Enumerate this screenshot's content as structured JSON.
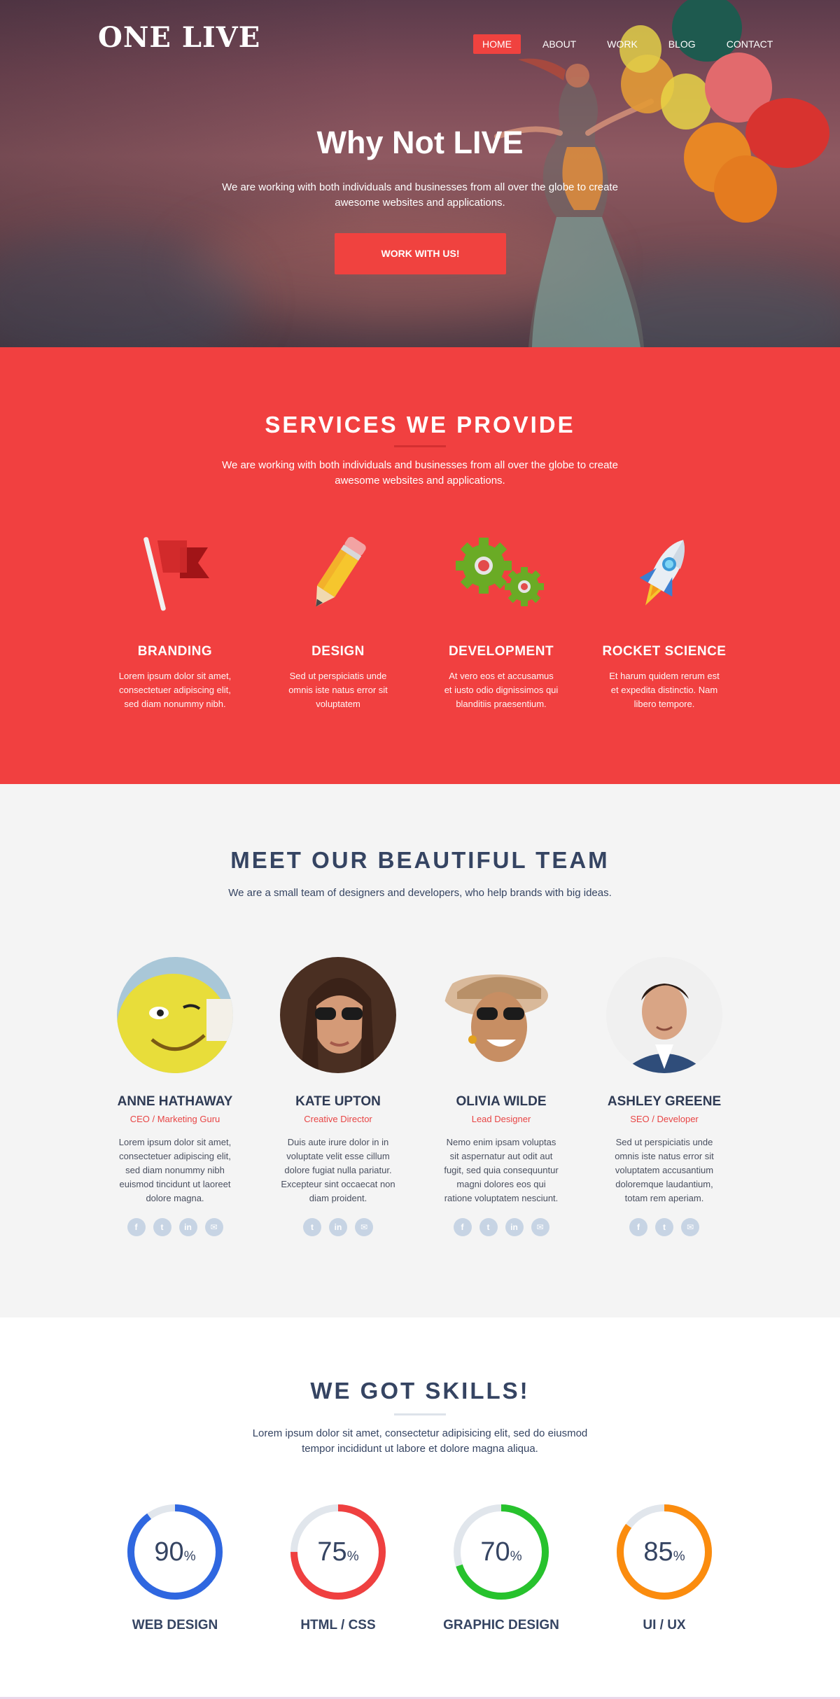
{
  "brand": {
    "logo": "ONE LIVE"
  },
  "nav": {
    "items": [
      "HOME",
      "ABOUT",
      "WORK",
      "BLOG",
      "CONTACT"
    ],
    "active": "HOME"
  },
  "hero": {
    "title_light": "Why Not ",
    "title_bold": "LIVE",
    "subtitle": "We are working with both individuals and businesses from all over the globe to create awesome websites and applications.",
    "cta": "WORK WITH US!"
  },
  "services": {
    "title": "SERVICES WE PROVIDE",
    "subtitle": "We are working with both individuals and businesses from all over the globe to create awesome websites and applications.",
    "items": [
      {
        "icon": "flag-icon",
        "title": "BRANDING",
        "text": "Lorem ipsum dolor sit amet, consectetuer adipiscing elit, sed diam nonummy nibh."
      },
      {
        "icon": "pencil-icon",
        "title": "DESIGN",
        "text": "Sed ut perspiciatis unde omnis iste natus error sit voluptatem"
      },
      {
        "icon": "gears-icon",
        "title": "DEVELOPMENT",
        "text": "At vero eos et accusamus et iusto odio dignissimos qui blanditiis praesentium."
      },
      {
        "icon": "rocket-icon",
        "title": "ROCKET SCIENCE",
        "text": "Et harum quidem rerum est et expedita distinctio. Nam libero tempore."
      }
    ]
  },
  "team": {
    "title": "MEET OUR BEAUTIFUL TEAM",
    "subtitle": "We are a small team of designers and developers, who help brands with big ideas.",
    "members": [
      {
        "name": "ANNE HATHAWAY",
        "role": "CEO / Marketing Guru",
        "bio": "Lorem ipsum dolor sit amet, consectetuer adipiscing elit, sed diam nonummy nibh euismod tincidunt ut laoreet dolore magna.",
        "socials": [
          "facebook-icon",
          "twitter-icon",
          "linkedin-icon",
          "mail-icon"
        ]
      },
      {
        "name": "KATE UPTON",
        "role": "Creative Director",
        "bio": "Duis aute irure dolor in in voluptate velit esse cillum dolore fugiat nulla pariatur. Excepteur sint occaecat non diam proident.",
        "socials": [
          "twitter-icon",
          "linkedin-icon",
          "mail-icon"
        ]
      },
      {
        "name": "OLIVIA WILDE",
        "role": "Lead Designer",
        "bio": "Nemo enim ipsam voluptas sit aspernatur aut odit aut fugit, sed quia consequuntur magni dolores eos qui ratione voluptatem nesciunt.",
        "socials": [
          "facebook-icon",
          "twitter-icon",
          "linkedin-icon",
          "mail-icon"
        ]
      },
      {
        "name": "ASHLEY GREENE",
        "role": "SEO / Developer",
        "bio": "Sed ut perspiciatis unde omnis iste natus error sit voluptatem accusantium doloremque laudantium, totam rem aperiam.",
        "socials": [
          "facebook-icon",
          "twitter-icon",
          "mail-icon"
        ]
      }
    ]
  },
  "skills": {
    "title": "WE GOT SKILLS!",
    "subtitle": "Lorem ipsum dolor sit amet, consectetur adipisicing elit, sed do eiusmod tempor incididunt ut labore et dolore magna aliqua.",
    "items": [
      {
        "label": "WEB DESIGN",
        "value": "90",
        "unit": "%",
        "fraction": 0.9,
        "color": "#2f67e0"
      },
      {
        "label": "HTML / CSS",
        "value": "75",
        "unit": "%",
        "fraction": 0.75,
        "color": "#ef4040"
      },
      {
        "label": "GRAPHIC DESIGN",
        "value": "70",
        "unit": "%",
        "fraction": 0.7,
        "color": "#27c22d"
      },
      {
        "label": "UI / UX",
        "value": "85",
        "unit": "%",
        "fraction": 0.85,
        "color": "#fb8c0e"
      }
    ]
  },
  "colors": {
    "accent": "#f0423f",
    "navy": "#354462",
    "track": "#e1e6ec"
  }
}
